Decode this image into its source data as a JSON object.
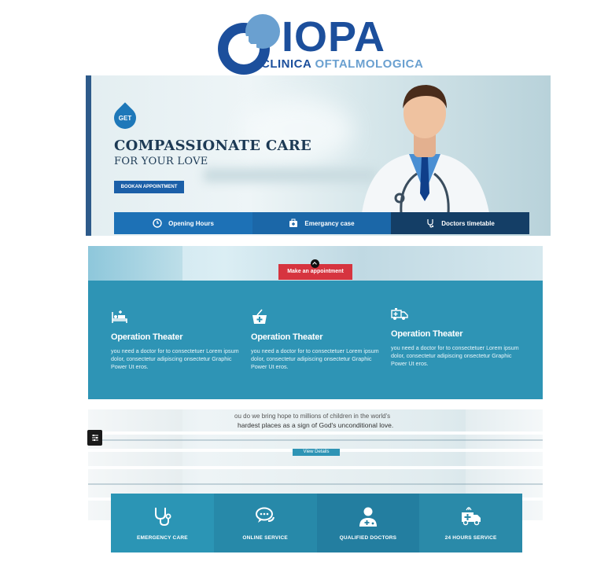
{
  "logo": {
    "name": "IOPA",
    "sub_word1": "CLINICA",
    "sub_word2": "OFTALMOLOGICA",
    "colors": {
      "primary": "#1c4f9c",
      "secondary": "#6aa0d0"
    }
  },
  "hero": {
    "badge": "GET",
    "title": "COMPASSIONATE CARE",
    "subtitle": "FOR YOUR LOVE",
    "book_button": "BOOKAN APPOINTMENT",
    "info_bar": [
      {
        "label": "Opening Hours",
        "icon": "clock-icon"
      },
      {
        "label": "Emergancy case",
        "icon": "first-aid-kit-icon"
      },
      {
        "label": "Doctors timetable",
        "icon": "stethoscope-icon"
      }
    ]
  },
  "features": {
    "appointment_button": "Make an appointment",
    "items": [
      {
        "icon": "hospital-bed-icon",
        "title": "Operation Theater",
        "description": "you need a doctor for to consectetuer Lorem ipsum dolor, consectetur adipiscing onsectetur Graphic Power Ut eros."
      },
      {
        "icon": "medical-basket-icon",
        "title": "Operation Theater",
        "description": "you need a doctor for to consectetuer Lorem ipsum dolor, consectetur adipiscing onsectetur Graphic Power Ut eros."
      },
      {
        "icon": "ambulance-icon",
        "title": "Operation Theater",
        "description": "you need a doctor for to consectetuer Lorem ipsum dolor, consectetur adipiscing onsectetur Graphic Power Ut eros."
      }
    ]
  },
  "bottom": {
    "story_line1": "ou do we bring hope to millions of children in the world's",
    "story_line2": "hardest places as a sign of God's unconditional love.",
    "view_button": "View Details",
    "services": [
      {
        "label": "EMERGENCY CARE",
        "icon": "stethoscope-icon"
      },
      {
        "label": "ONLINE SERVICE",
        "icon": "chat-bubbles-icon"
      },
      {
        "label": "QUALIFIED DOCTORS",
        "icon": "doctor-icon"
      },
      {
        "label": "24 HOURS SERVICE",
        "icon": "ambulance-icon"
      }
    ]
  },
  "colors": {
    "brand_blue": "#1d71b6",
    "navy": "#143e66",
    "teal": "#2e94b5",
    "appointment_red": "#d6343f"
  }
}
